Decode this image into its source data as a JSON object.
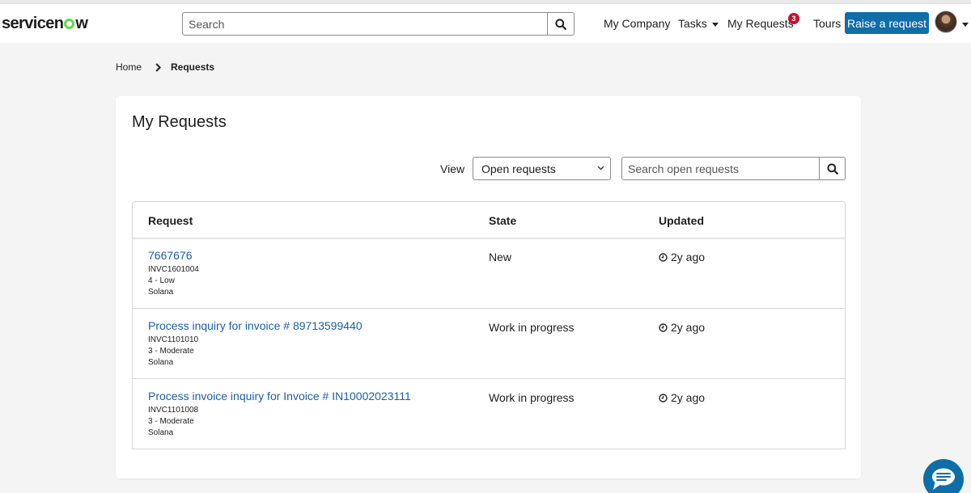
{
  "header": {
    "logo": {
      "pre": "servicen",
      "post": "w"
    },
    "search_placeholder": "Search",
    "nav": {
      "company": "My Company",
      "tasks": "Tasks",
      "requests": "My Requests",
      "requests_badge": "3",
      "tours": "Tours",
      "raise": "Raise a request"
    }
  },
  "breadcrumb": {
    "home": "Home",
    "current": "Requests"
  },
  "card": {
    "title": "My Requests",
    "view_label": "View",
    "view_selected": "Open requests",
    "search_placeholder": "Search open requests"
  },
  "table": {
    "headers": {
      "request": "Request",
      "state": "State",
      "updated": "Updated"
    },
    "rows": [
      {
        "link": "7667676",
        "number": "INVC1601004",
        "priority": "4 - Low",
        "company": "Solana",
        "state": "New",
        "updated": "2y ago"
      },
      {
        "link": "Process inquiry for invoice # 89713599440",
        "number": "INVC1101010",
        "priority": "3 - Moderate",
        "company": "Solana",
        "state": "Work in progress",
        "updated": "2y ago"
      },
      {
        "link": "Process invoice inquiry for Invoice # IN10002023111",
        "number": "INVC1101008",
        "priority": "3 - Moderate",
        "company": "Solana",
        "state": "Work in progress",
        "updated": "2y ago"
      }
    ]
  },
  "colors": {
    "accent": "#0f6ea8",
    "link": "#1a5fa8",
    "badge": "#c8102e",
    "logo_ring": "#62d84e",
    "page_bg": "#f4f4f4"
  },
  "icons": {
    "search": "search-icon",
    "clock": "clock-icon",
    "chat": "chat-icon",
    "breadcrumb_sep": "chevron-right-icon",
    "select": "chevron-down-icon"
  }
}
